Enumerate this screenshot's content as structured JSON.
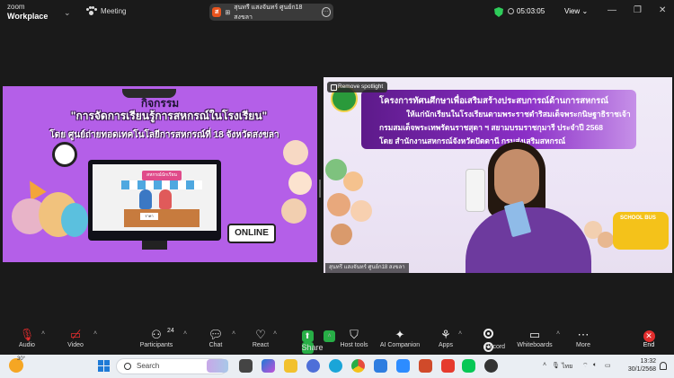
{
  "titlebar": {
    "brand_top": "zoom",
    "brand_bottom": "Workplace",
    "meeting_label": "Meeting",
    "share_initial": "ส",
    "share_name": "สุนทรี แสงจันทร์ ศูนย์ก18 สงขลา",
    "timer": "05:03:05",
    "view_label": "View",
    "colors": {
      "security": "#2ecc5a",
      "share_avatar": "#e8541e"
    }
  },
  "left_slide": {
    "title_line1": "กิจกรรม",
    "title_line2": "\"การจัดการเรียนรู้การสหกรณ์ในโรงเรียน\"",
    "title_line3": "โดย ศูนย์ถ่ายทอดเทคโนโลยีการสหกรณ์ที่ 18 จังหวัดสงขลา",
    "shop_sign": "สหกรณ์นักเรียน",
    "price_tag": "ราคา",
    "online_badge": "ONLINE"
  },
  "right_video": {
    "spotlight_button": "Remove spotlight",
    "banner_line1": "โครงการทัศนศึกษาเพื่อเสริมสร้างประสบการณ์ด้านการสหกรณ์",
    "banner_line2": "ให้แก่นักเรียนในโรงเรียนตามพระราชดำริสมเด็จพระกนิษฐาธิราชเจ้า",
    "banner_line3": "กรมสมเด็จพระเทพรัตนราชสุดา ฯ สยามบรมราชกุมารี ประจำปี 2568",
    "banner_line4": "โดย สำนักงานสหกรณ์จังหวัดปัตตานี กรมส่งเสริมสหกรณ์",
    "bus_label": "SCHOOL BUS",
    "participant_name": "สุนทรี แสงจันทร์ ศูนย์ก18 สงขลา"
  },
  "toolbar": {
    "audio": "Audio",
    "video": "Video",
    "participants": "Participants",
    "participants_count": "24",
    "chat": "Chat",
    "react": "React",
    "share": "Share",
    "host_tools": "Host tools",
    "ai_companion": "AI Companion",
    "apps": "Apps",
    "record": "Record",
    "whiteboards": "Whiteboards",
    "more": "More",
    "end": "End",
    "colors": {
      "share": "#27ae46",
      "end": "#e22d2d"
    }
  },
  "taskbar": {
    "temperature": "30°",
    "search_placeholder": "Search",
    "language": "ไทย",
    "time": "13:32",
    "date": "30/1/2568"
  }
}
